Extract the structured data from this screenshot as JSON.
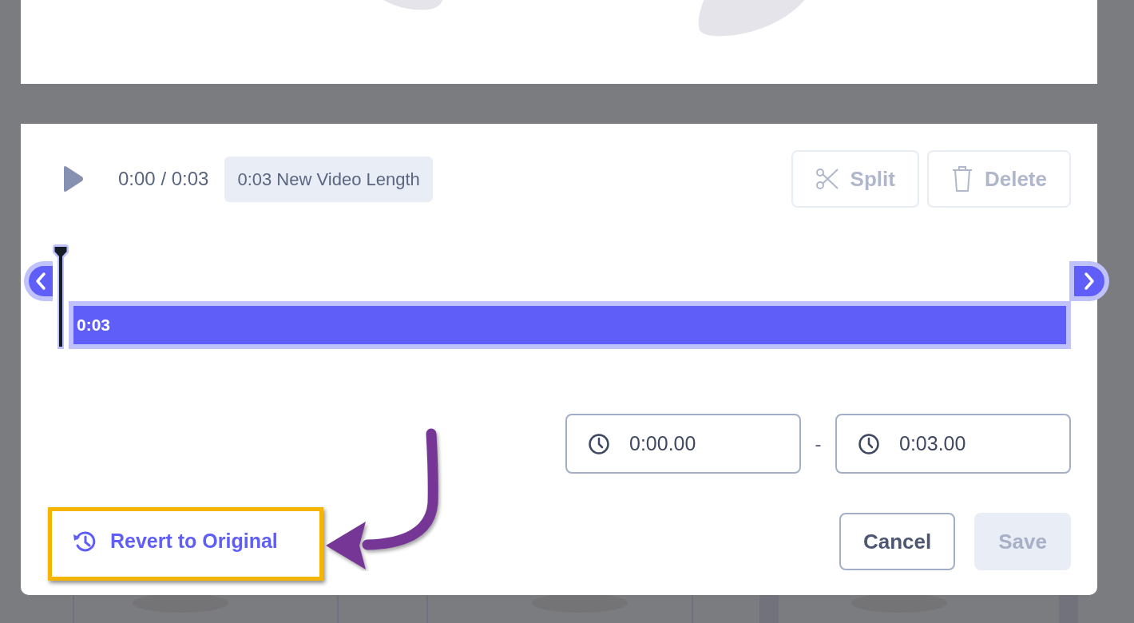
{
  "player": {
    "time": "0:00 / 0:03",
    "length_badge": "0:03 New Video Length"
  },
  "tools": [
    {
      "kind": "split",
      "label": "Split",
      "disabled": true
    },
    {
      "kind": "delete",
      "label": "Delete",
      "disabled": true
    }
  ],
  "timeline": {
    "clip_label": "0:03",
    "playhead": {
      "level": 0
    }
  },
  "range": {
    "start": "0:00.00",
    "separator": "-",
    "end": "0:03.00"
  },
  "revert": {
    "label": "Revert to Original",
    "highlighted": true
  },
  "actions": [
    {
      "kind": "cancel",
      "label": "Cancel",
      "disabled": false
    },
    {
      "kind": "save",
      "label": "Save",
      "disabled": true
    }
  ]
}
